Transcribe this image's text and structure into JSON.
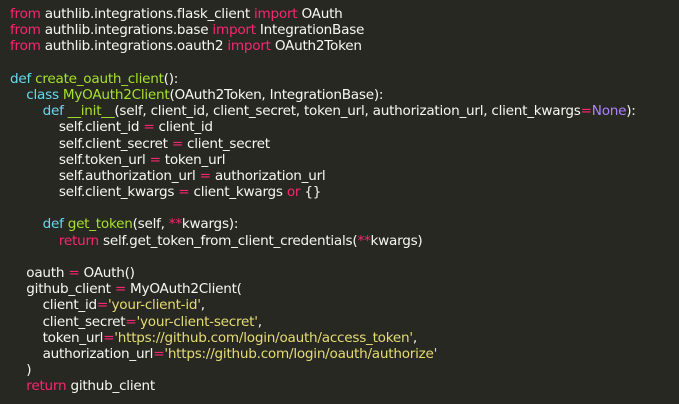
{
  "colors": {
    "background": "#272822",
    "text": "#f8f8f2",
    "keyword": "#f92672",
    "storage": "#66d9ef",
    "function": "#a6e22e",
    "string": "#e6db74",
    "constant": "#ae81ff"
  },
  "code": {
    "lines": [
      [
        [
          "kw",
          "from"
        ],
        [
          "plain",
          " authlib.integrations.flask_client "
        ],
        [
          "kw",
          "import"
        ],
        [
          "plain",
          " OAuth"
        ]
      ],
      [
        [
          "kw",
          "from"
        ],
        [
          "plain",
          " authlib.integrations.base "
        ],
        [
          "kw",
          "import"
        ],
        [
          "plain",
          " IntegrationBase"
        ]
      ],
      [
        [
          "kw",
          "from"
        ],
        [
          "plain",
          " authlib.integrations.oauth2 "
        ],
        [
          "kw",
          "import"
        ],
        [
          "plain",
          " OAuth2Token"
        ]
      ],
      [],
      [
        [
          "def",
          "def"
        ],
        [
          "plain",
          " "
        ],
        [
          "fn",
          "create_oauth_client"
        ],
        [
          "plain",
          "():"
        ]
      ],
      [
        [
          "plain",
          "    "
        ],
        [
          "def",
          "class"
        ],
        [
          "plain",
          " "
        ],
        [
          "fn",
          "MyOAuth2Client"
        ],
        [
          "plain",
          "(OAuth2Token, IntegrationBase):"
        ]
      ],
      [
        [
          "plain",
          "        "
        ],
        [
          "def",
          "def"
        ],
        [
          "plain",
          " "
        ],
        [
          "fn",
          "__init__"
        ],
        [
          "plain",
          "(self, client_id, client_secret, token_url, authorization_url, client_kwargs"
        ],
        [
          "kw",
          "="
        ],
        [
          "const",
          "None"
        ],
        [
          "plain",
          "):"
        ]
      ],
      [
        [
          "plain",
          "            self.client_id "
        ],
        [
          "kw",
          "="
        ],
        [
          "plain",
          " client_id"
        ]
      ],
      [
        [
          "plain",
          "            self.client_secret "
        ],
        [
          "kw",
          "="
        ],
        [
          "plain",
          " client_secret"
        ]
      ],
      [
        [
          "plain",
          "            self.token_url "
        ],
        [
          "kw",
          "="
        ],
        [
          "plain",
          " token_url"
        ]
      ],
      [
        [
          "plain",
          "            self.authorization_url "
        ],
        [
          "kw",
          "="
        ],
        [
          "plain",
          " authorization_url"
        ]
      ],
      [
        [
          "plain",
          "            self.client_kwargs "
        ],
        [
          "kw",
          "="
        ],
        [
          "plain",
          " client_kwargs "
        ],
        [
          "kw",
          "or"
        ],
        [
          "plain",
          " {}"
        ]
      ],
      [],
      [
        [
          "plain",
          "        "
        ],
        [
          "def",
          "def"
        ],
        [
          "plain",
          " "
        ],
        [
          "fn",
          "get_token"
        ],
        [
          "plain",
          "(self, "
        ],
        [
          "kw",
          "**"
        ],
        [
          "plain",
          "kwargs):"
        ]
      ],
      [
        [
          "plain",
          "            "
        ],
        [
          "kw",
          "return"
        ],
        [
          "plain",
          " self.get_token_from_client_credentials("
        ],
        [
          "kw",
          "**"
        ],
        [
          "plain",
          "kwargs)"
        ]
      ],
      [],
      [
        [
          "plain",
          "    oauth "
        ],
        [
          "kw",
          "="
        ],
        [
          "plain",
          " OAuth()"
        ]
      ],
      [
        [
          "plain",
          "    github_client "
        ],
        [
          "kw",
          "="
        ],
        [
          "plain",
          " MyOAuth2Client("
        ]
      ],
      [
        [
          "plain",
          "        client_id"
        ],
        [
          "kw",
          "="
        ],
        [
          "str",
          "'your-client-id'"
        ],
        [
          "plain",
          ","
        ]
      ],
      [
        [
          "plain",
          "        client_secret"
        ],
        [
          "kw",
          "="
        ],
        [
          "str",
          "'your-client-secret'"
        ],
        [
          "plain",
          ","
        ]
      ],
      [
        [
          "plain",
          "        token_url"
        ],
        [
          "kw",
          "="
        ],
        [
          "str",
          "'https://github.com/login/oauth/access_token'"
        ],
        [
          "plain",
          ","
        ]
      ],
      [
        [
          "plain",
          "        authorization_url"
        ],
        [
          "kw",
          "="
        ],
        [
          "str",
          "'https://github.com/login/oauth/authorize'"
        ]
      ],
      [
        [
          "plain",
          "    )"
        ]
      ],
      [
        [
          "plain",
          "    "
        ],
        [
          "kw",
          "return"
        ],
        [
          "plain",
          " github_client"
        ]
      ]
    ]
  }
}
